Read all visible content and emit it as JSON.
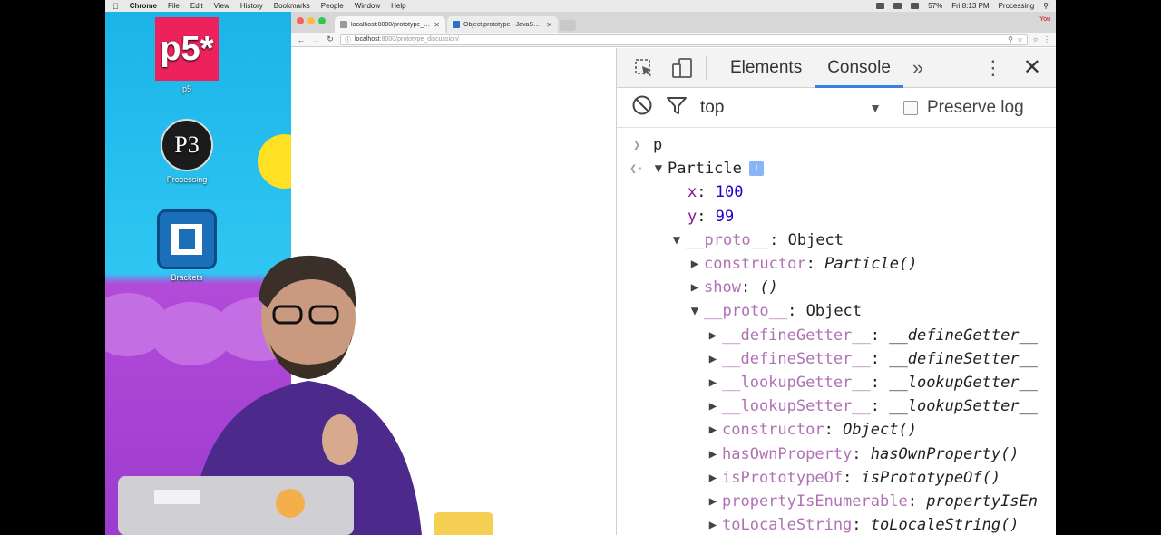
{
  "menubar": {
    "app": "Chrome",
    "items": [
      "File",
      "Edit",
      "View",
      "History",
      "Bookmarks",
      "People",
      "Window",
      "Help"
    ],
    "battery": "57%",
    "clock": "Fri 8:13 PM",
    "active_app": "Processing"
  },
  "desktop": {
    "icons": [
      {
        "label": "p5",
        "glyph": "p5*"
      },
      {
        "label": "Processing",
        "glyph": "P3"
      },
      {
        "label": "Brackets",
        "glyph": ""
      }
    ]
  },
  "browser": {
    "tabs": [
      {
        "label": "localhost:8000/prototype_di..."
      },
      {
        "label": "Object.prototype - JavaScript"
      }
    ],
    "user": "You",
    "url_host": "localhost",
    "url_rest": ":8000/prototype_discussion/"
  },
  "devtools": {
    "tabs": [
      {
        "label": "Elements"
      },
      {
        "label": "Console"
      }
    ],
    "context": "top",
    "preserve_log": "Preserve log"
  },
  "console": {
    "input": "p",
    "object_name": "Particle",
    "info_badge": "i",
    "x_key": "x",
    "x_val": "100",
    "y_key": "y",
    "y_val": "99",
    "proto1_key": "__proto__",
    "proto1_val": "Object",
    "constructor_key": "constructor",
    "constructor_val": "Particle()",
    "show_key": "show",
    "show_val": "()",
    "proto2_key": "__proto__",
    "proto2_val": "Object",
    "entries": [
      {
        "key": "__defineGetter__",
        "val": "__defineGetter__",
        "dim": true
      },
      {
        "key": "__defineSetter__",
        "val": "__defineSetter__",
        "dim": true
      },
      {
        "key": "__lookupGetter__",
        "val": "__lookupGetter__",
        "dim": true
      },
      {
        "key": "__lookupSetter__",
        "val": "__lookupSetter__",
        "dim": true
      },
      {
        "key": "constructor",
        "val": "Object()",
        "dim": true
      },
      {
        "key": "hasOwnProperty",
        "val": "hasOwnProperty()",
        "dim": true
      },
      {
        "key": "isPrototypeOf",
        "val": "isPrototypeOf()",
        "dim": true
      },
      {
        "key": "propertyIsEnumerable",
        "val": "propertyIsEn",
        "dim": true
      },
      {
        "key": "toLocaleString",
        "val": "toLocaleString()",
        "dim": true
      }
    ]
  },
  "colors": {
    "accent_tab": "#3b7de9",
    "key_purple": "#881391",
    "number_blue": "#1c00cf"
  }
}
